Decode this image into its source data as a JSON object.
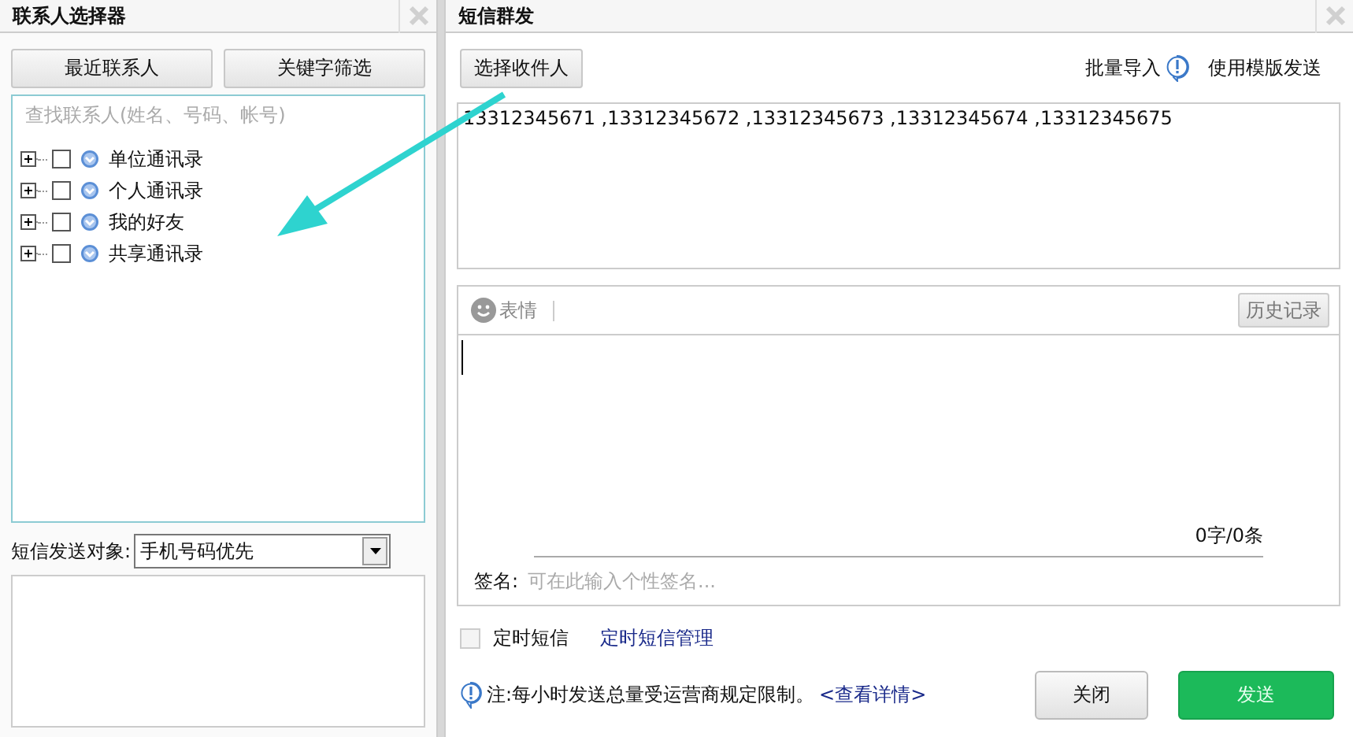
{
  "left_panel": {
    "title": "联系人选择器",
    "buttons": [
      "最近联系人",
      "关键字筛选"
    ],
    "search": {
      "placeholder": "查找联系人(姓名、号码、帐号)"
    },
    "tree": [
      {
        "label": "单位通讯录",
        "expanded": false,
        "checked": false
      },
      {
        "label": "个人通讯录",
        "expanded": false,
        "checked": false
      },
      {
        "label": "我的好友",
        "expanded": false,
        "checked": false
      },
      {
        "label": "共享通讯录",
        "expanded": false,
        "checked": false
      }
    ],
    "send_target": {
      "label": "短信发送对象:",
      "value": "手机号码优先"
    }
  },
  "right_panel": {
    "title": "短信群发",
    "choose_button": "选择收件人",
    "links": [
      "批量导入",
      "使用模版发送"
    ],
    "recipients": "13312345671 ,13312345672 ,13312345673 ,13312345674 ,13312345675",
    "emoji_label": "表情",
    "history_button": "历史记录",
    "counter": "0字/0条",
    "signature": {
      "label": "签名:",
      "placeholder": "可在此输入个性签名..."
    },
    "scheduled": {
      "label": "定时短信",
      "checked": false
    },
    "schedule_link": "定时短信管理",
    "note": "注:每小时发送总量受运营商规定限制。",
    "note_link": "<查看详情>",
    "buttons": [
      {
        "label": "关闭",
        "kind": "secondary"
      },
      {
        "label": "发送",
        "kind": "primary"
      }
    ]
  }
}
